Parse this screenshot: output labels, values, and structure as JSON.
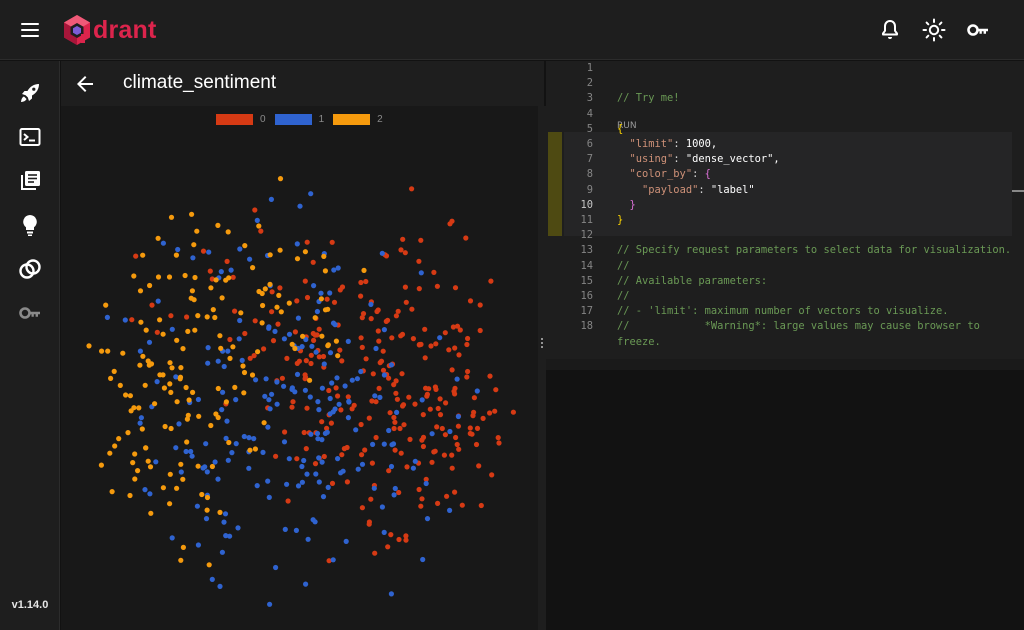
{
  "app": {
    "name": "Qdrant",
    "logo_text": "drant",
    "version": "v1.14.0"
  },
  "header": {
    "icons": [
      "notifications-icon",
      "theme-toggle-icon",
      "api-key-icon"
    ]
  },
  "sidebar": {
    "items": [
      {
        "name": "welcome",
        "icon": "rocket-icon"
      },
      {
        "name": "console",
        "icon": "terminal-icon"
      },
      {
        "name": "collections",
        "icon": "library-icon"
      },
      {
        "name": "tutorial",
        "icon": "lightbulb-icon"
      },
      {
        "name": "datasets",
        "icon": "rings-icon"
      },
      {
        "name": "access-tokens",
        "icon": "key-icon"
      }
    ]
  },
  "visualization": {
    "title": "climate_sentiment",
    "legend": [
      {
        "label": "0",
        "color": "#d63a14"
      },
      {
        "label": "1",
        "color": "#2f63d0"
      },
      {
        "label": "2",
        "color": "#f59a0d"
      }
    ],
    "point_count": 1000
  },
  "editor": {
    "run_label": "RUN",
    "active_line": 10,
    "lines": [
      {
        "n": "1",
        "text": ""
      },
      {
        "n": "2",
        "text": ""
      },
      {
        "n": "3",
        "text": "// Try me!"
      },
      {
        "n": "4",
        "text": ""
      },
      {
        "n": "5",
        "text": "{"
      },
      {
        "n": "6",
        "text": "  \"limit\": 1000,"
      },
      {
        "n": "7",
        "text": "  \"using\": \"dense_vector\","
      },
      {
        "n": "8",
        "text": "  \"color_by\": {"
      },
      {
        "n": "9",
        "text": "    \"payload\": \"label\""
      },
      {
        "n": "10",
        "text": "  }"
      },
      {
        "n": "11",
        "text": "}"
      },
      {
        "n": "12",
        "text": ""
      },
      {
        "n": "13",
        "text": "// Specify request parameters to select data for visualization."
      },
      {
        "n": "14",
        "text": "//"
      },
      {
        "n": "15",
        "text": "// Available parameters:"
      },
      {
        "n": "16",
        "text": "//"
      },
      {
        "n": "17",
        "text": "// - 'limit': maximum number of vectors to visualize."
      },
      {
        "n": "18",
        "text": "//            *Warning*: large values may cause browser to"
      },
      {
        "n": "",
        "text": "freeze."
      }
    ]
  },
  "colors": {
    "brand": "#dc244c",
    "background": "#121212",
    "panel": "#1e1e1e"
  }
}
